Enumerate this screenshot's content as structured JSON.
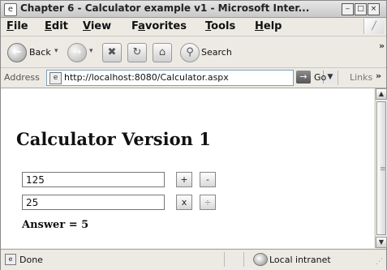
{
  "window": {
    "title": "Chapter 6 - Calculator example v1 - Microsoft Inter...",
    "controls": {
      "minimize": "‒",
      "maximize": "□",
      "close": "×"
    }
  },
  "menu": {
    "items": [
      {
        "key": "F",
        "rest": "ile"
      },
      {
        "key": "E",
        "rest": "dit"
      },
      {
        "key": "V",
        "rest": "iew"
      },
      {
        "pre": "F",
        "key": "a",
        "rest": "vorites"
      },
      {
        "key": "T",
        "rest": "ools"
      },
      {
        "key": "H",
        "rest": "elp"
      }
    ]
  },
  "toolbar": {
    "back_label": "Back",
    "search_label": "Search"
  },
  "address": {
    "label": "Address",
    "url": "http://localhost:8080/Calculator.aspx",
    "go_label": "Go",
    "links_label": "Links"
  },
  "page": {
    "title": "Calculator Version 1",
    "input1_value": "125",
    "input2_value": "25",
    "buttons": {
      "add": "+",
      "subtract": "-",
      "multiply": "x",
      "divide": "÷"
    },
    "answer_text": "Answer = 5"
  },
  "status": {
    "text": "Done",
    "zone": "Local intranet"
  },
  "icons": {
    "app": "ie-icon",
    "back": "back-arrow-icon",
    "forward": "forward-arrow-icon",
    "stop": "stop-icon",
    "refresh": "refresh-icon",
    "home": "home-icon",
    "search": "magnifier-icon",
    "go": "go-arrow-icon",
    "zone": "intranet-icon"
  }
}
